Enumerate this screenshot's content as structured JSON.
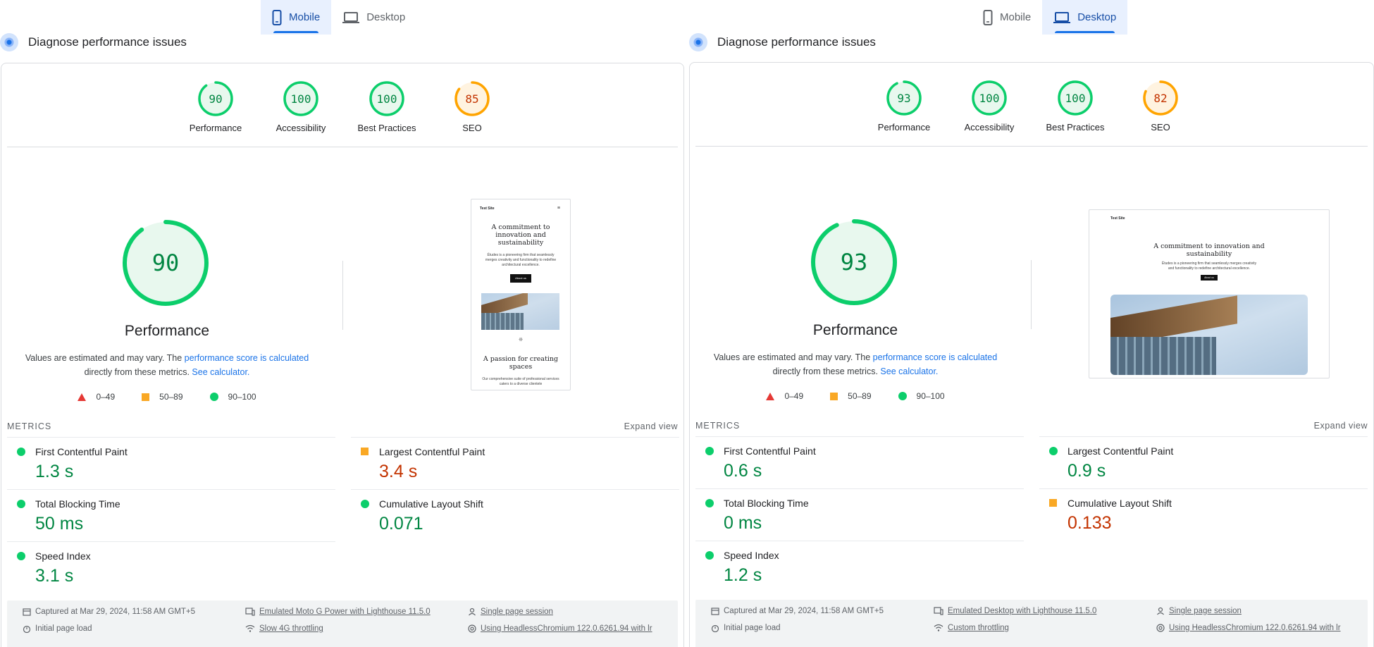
{
  "panels": [
    {
      "tabs": {
        "mobile": "Mobile",
        "desktop": "Desktop",
        "active": "mobile"
      },
      "section_title": "Diagnose performance issues",
      "categories": [
        {
          "label": "Performance",
          "score": "90",
          "status": "pass"
        },
        {
          "label": "Accessibility",
          "score": "100",
          "status": "pass"
        },
        {
          "label": "Best Practices",
          "score": "100",
          "status": "pass"
        },
        {
          "label": "SEO",
          "score": "85",
          "status": "average"
        }
      ],
      "performance": {
        "score": "90",
        "title": "Performance",
        "desc_prefix": "Values are estimated and may vary. The",
        "desc_link1": "performance score is calculated",
        "desc_mid": "directly from these metrics.",
        "desc_link2": "See calculator."
      },
      "legend": [
        "0–49",
        "50–89",
        "90–100"
      ],
      "screenshot": {
        "site_name": "Test Site",
        "heading": "A commitment to innovation and sustainability",
        "body": "Études is a pioneering firm that seamlessly merges creativity and functionality to redefine architectural excellence.",
        "button": "About us",
        "heading2": "A passion for creating spaces",
        "body2": "Our comprehensive suite of professional services caters to a diverse clientele"
      },
      "metrics_label": "METRICS",
      "expand_label": "Expand view",
      "metrics": [
        {
          "name": "First Contentful Paint",
          "value": "1.3 s",
          "status": "pass"
        },
        {
          "name": "Largest Contentful Paint",
          "value": "3.4 s",
          "status": "average"
        },
        {
          "name": "Total Blocking Time",
          "value": "50 ms",
          "status": "pass"
        },
        {
          "name": "Cumulative Layout Shift",
          "value": "0.071",
          "status": "pass"
        },
        {
          "name": "Speed Index",
          "value": "3.1 s",
          "status": "pass"
        }
      ],
      "footer": {
        "captured": "Captured at Mar 29, 2024, 11:58 AM GMT+5",
        "load": "Initial page load",
        "device": "Emulated Moto G Power with Lighthouse 11.5.0",
        "throttle": "Slow 4G throttling",
        "session": "Single page session",
        "browser": "Using HeadlessChromium 122.0.6261.94 with lr"
      }
    },
    {
      "tabs": {
        "mobile": "Mobile",
        "desktop": "Desktop",
        "active": "desktop"
      },
      "section_title": "Diagnose performance issues",
      "categories": [
        {
          "label": "Performance",
          "score": "93",
          "status": "pass"
        },
        {
          "label": "Accessibility",
          "score": "100",
          "status": "pass"
        },
        {
          "label": "Best Practices",
          "score": "100",
          "status": "pass"
        },
        {
          "label": "SEO",
          "score": "82",
          "status": "average"
        }
      ],
      "performance": {
        "score": "93",
        "title": "Performance",
        "desc_prefix": "Values are estimated and may vary. The",
        "desc_link1": "performance score is calculated",
        "desc_mid": "directly from these metrics.",
        "desc_link2": "See calculator."
      },
      "legend": [
        "0–49",
        "50–89",
        "90–100"
      ],
      "screenshot": {
        "site_name": "Test Site",
        "heading": "A commitment to innovation and sustainability",
        "body": "Études is a pioneering firm that seamlessly merges creativity and functionality to redefine architectural excellence.",
        "button": "About us"
      },
      "metrics_label": "METRICS",
      "expand_label": "Expand view",
      "metrics": [
        {
          "name": "First Contentful Paint",
          "value": "0.6 s",
          "status": "pass"
        },
        {
          "name": "Largest Contentful Paint",
          "value": "0.9 s",
          "status": "pass"
        },
        {
          "name": "Total Blocking Time",
          "value": "0 ms",
          "status": "pass"
        },
        {
          "name": "Cumulative Layout Shift",
          "value": "0.133",
          "status": "average"
        },
        {
          "name": "Speed Index",
          "value": "1.2 s",
          "status": "pass"
        }
      ],
      "footer": {
        "captured": "Captured at Mar 29, 2024, 11:58 AM GMT+5",
        "load": "Initial page load",
        "device": "Emulated Desktop with Lighthouse 11.5.0",
        "throttle": "Custom throttling",
        "session": "Single page session",
        "browser": "Using HeadlessChromium 122.0.6261.94 with lr"
      }
    }
  ],
  "colors": {
    "pass": "#0cce6b",
    "pass_text": "#018642",
    "pass_fill": "#e8f8ee",
    "average": "#ffa400",
    "average_text": "#c33300",
    "average_fill": "#fff3e0",
    "fail": "#ff4e42",
    "link": "#1a73e8"
  }
}
